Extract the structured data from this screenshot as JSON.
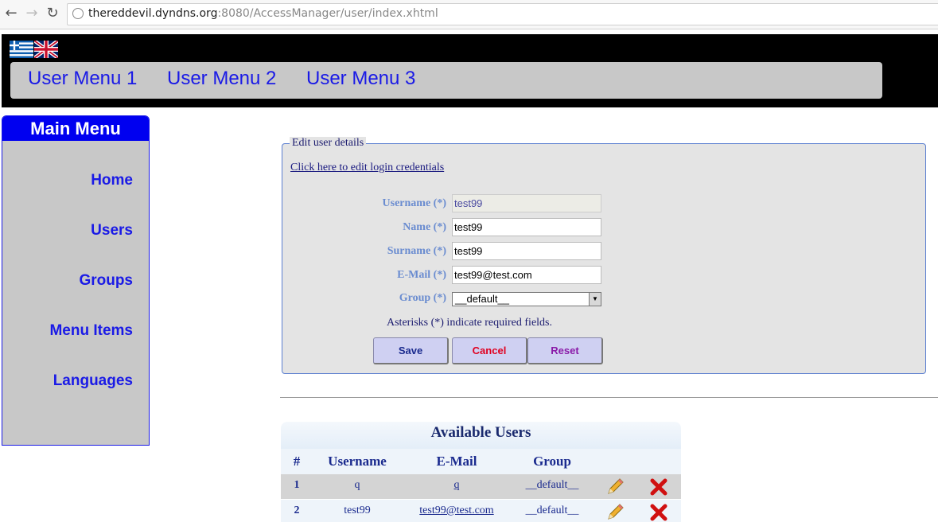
{
  "browser": {
    "url_host": "thereddevil.dyndns.org",
    "url_path": ":8080/AccessManager/user/index.xhtml"
  },
  "header": {
    "languages": [
      "Greek",
      "English"
    ],
    "menu": [
      {
        "label": "User Menu 1"
      },
      {
        "label": "User Menu 2"
      },
      {
        "label": "User Menu 3"
      }
    ]
  },
  "sidebar": {
    "title": "Main Menu",
    "items": [
      {
        "label": "Home"
      },
      {
        "label": "Users"
      },
      {
        "label": "Groups"
      },
      {
        "label": "Menu Items"
      },
      {
        "label": "Languages"
      }
    ]
  },
  "form": {
    "legend": "Edit user details",
    "credentials_link": "Click here to edit login credentials",
    "fields": {
      "username": {
        "label": "Username (*)",
        "value": "test99"
      },
      "name": {
        "label": "Name (*)",
        "value": "test99"
      },
      "surname": {
        "label": "Surname (*)",
        "value": "test99"
      },
      "email": {
        "label": "E-Mail (*)",
        "value": "test99@test.com"
      },
      "group": {
        "label": "Group (*)",
        "value": "__default__"
      }
    },
    "note": "Asterisks (*) indicate required fields.",
    "buttons": {
      "save": "Save",
      "cancel": "Cancel",
      "reset": "Reset"
    },
    "button_colors": {
      "save": "#1a2a8e",
      "cancel": "#e00020",
      "reset": "#8a1aa8"
    }
  },
  "users_table": {
    "title": "Available Users",
    "columns": [
      "#",
      "Username",
      "E-Mail",
      "Group"
    ],
    "rows": [
      {
        "num": "1",
        "username": "q",
        "email": "q",
        "group": "__default__"
      },
      {
        "num": "2",
        "username": "test99",
        "email": "test99@test.com",
        "group": "__default__"
      }
    ],
    "row_actions": [
      "edit-icon",
      "delete-icon"
    ]
  }
}
